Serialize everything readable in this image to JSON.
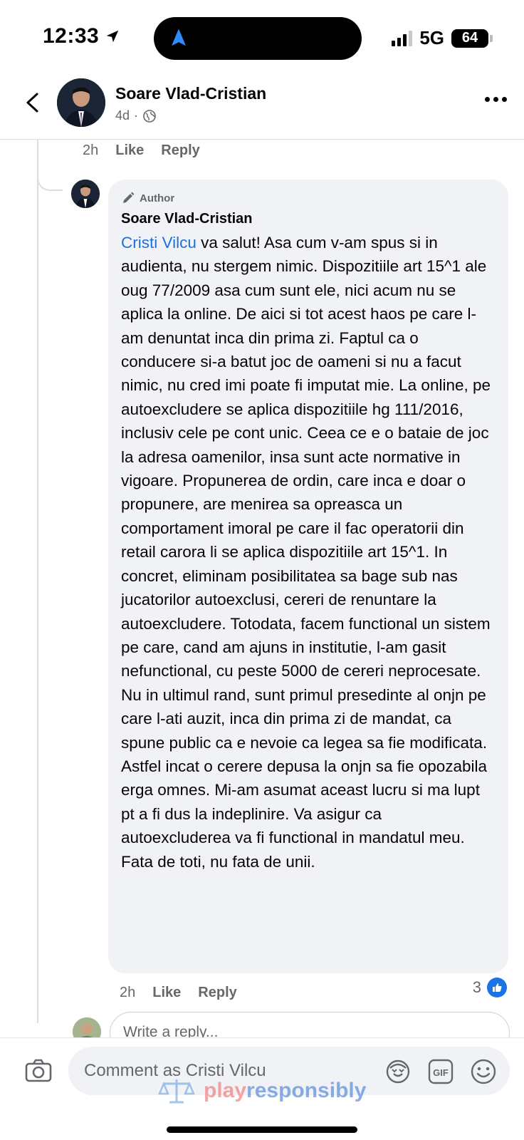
{
  "status_bar": {
    "time": "12:33",
    "network": "5G",
    "battery": "64"
  },
  "header": {
    "name": "Soare Vlad-Cristian",
    "age": "4d",
    "separator": "·"
  },
  "prev_comment": {
    "time": "2h",
    "like": "Like",
    "reply": "Reply"
  },
  "comment": {
    "tag": "Author",
    "name": "Soare Vlad-Cristian",
    "mention": "Cristi Vilcu",
    "text": " va salut! Asa cum v-am spus si in audienta, nu stergem nimic. Dispozitiile art 15^1 ale oug 77/2009 asa cum sunt ele, nici acum nu se aplica la online. De aici si tot acest haos pe care l-am denuntat inca din prima zi. Faptul ca o conducere si-a batut joc de oameni si nu a facut nimic, nu cred imi poate fi imputat mie. La online, pe autoexcludere se aplica dispozitiile hg 111/2016, inclusiv cele pe cont unic. Ceea ce e o bataie de joc la adresa oamenilor, insa sunt acte normative in vigoare. Propunerea de ordin, care inca e doar o propunere, are menirea sa opreasca un comportament imoral pe care il fac operatorii din retail carora li se aplica dispozitiile art 15^1. In concret, eliminam posibilitatea sa bage sub nas jucatorilor autoexclusi, cereri de renuntare la autoexcludere. Totodata, facem functional un sistem pe care, cand am ajuns in institutie, l-am gasit nefunctional, cu peste 5000 de cereri neprocesate.\nNu in ultimul rand, sunt primul presedinte al onjn pe care l-ati auzit, inca din prima zi de mandat, ca spune public ca e nevoie ca legea sa fie modificata. Astfel incat o cerere depusa la onjn sa fie opozabila erga omnes. Mi-am asumat aceast lucru si ma lupt pt a fi dus la indeplinire. Va asigur ca autoexcluderea va fi functional in mandatul meu. Fata de toti, nu fata de unii.",
    "time": "2h",
    "like": "Like",
    "reply": "Reply",
    "reaction_count": "3"
  },
  "write_reply": {
    "placeholder": "Write a reply..."
  },
  "composer": {
    "placeholder": "Comment as Cristi Vilcu"
  },
  "watermark": {
    "play": "play",
    "responsibly": "responsibly"
  },
  "colors": {
    "link": "#216fdb",
    "like_blue": "#1b74e4",
    "bubble": "#f0f2f5"
  }
}
